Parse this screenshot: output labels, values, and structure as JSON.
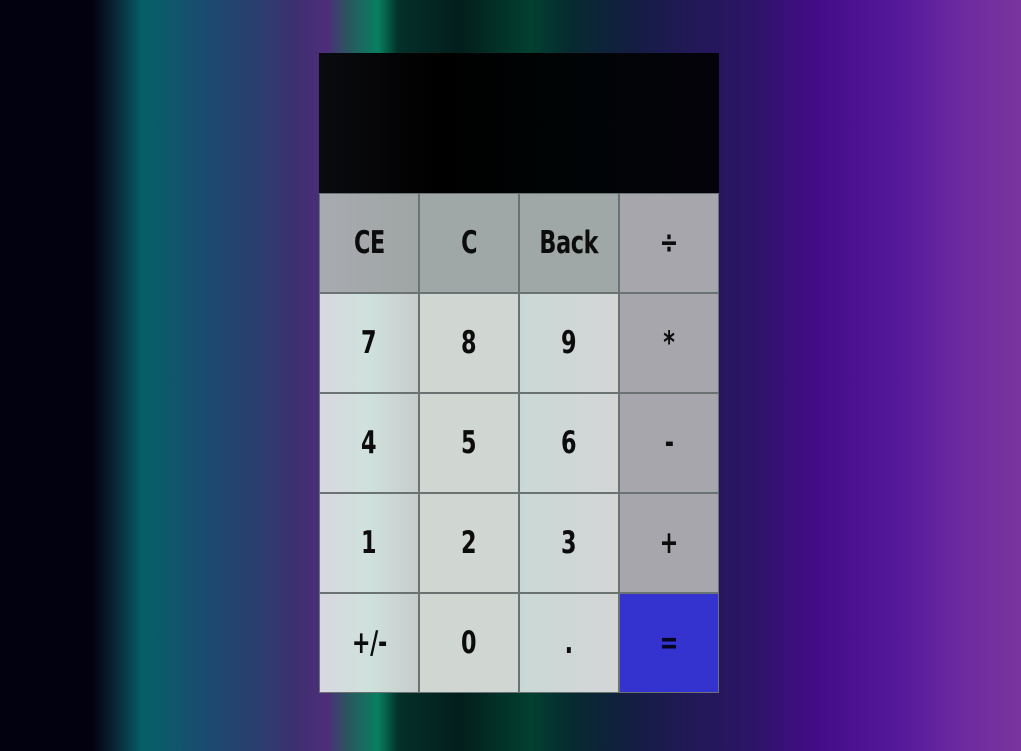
{
  "display": {
    "value": ""
  },
  "keys": [
    {
      "label": "CE",
      "name": "clear-entry-button",
      "kind": "fn"
    },
    {
      "label": "C",
      "name": "clear-button",
      "kind": "fn2"
    },
    {
      "label": "Back",
      "name": "backspace-button",
      "kind": "fn2"
    },
    {
      "label": "÷",
      "name": "divide-button",
      "kind": "op"
    },
    {
      "label": "7",
      "name": "digit-7-button",
      "kind": "num1"
    },
    {
      "label": "8",
      "name": "digit-8-button",
      "kind": "num2"
    },
    {
      "label": "9",
      "name": "digit-9-button",
      "kind": "num3"
    },
    {
      "label": "*",
      "name": "multiply-button",
      "kind": "op"
    },
    {
      "label": "4",
      "name": "digit-4-button",
      "kind": "num1"
    },
    {
      "label": "5",
      "name": "digit-5-button",
      "kind": "num2"
    },
    {
      "label": "6",
      "name": "digit-6-button",
      "kind": "num3"
    },
    {
      "label": "-",
      "name": "subtract-button",
      "kind": "op"
    },
    {
      "label": "1",
      "name": "digit-1-button",
      "kind": "num1"
    },
    {
      "label": "2",
      "name": "digit-2-button",
      "kind": "num2"
    },
    {
      "label": "3",
      "name": "digit-3-button",
      "kind": "num3"
    },
    {
      "label": "+",
      "name": "add-button",
      "kind": "op"
    },
    {
      "label": "+/-",
      "name": "toggle-sign-button",
      "kind": "num1"
    },
    {
      "label": "0",
      "name": "digit-0-button",
      "kind": "num2"
    },
    {
      "label": ".",
      "name": "decimal-point-button",
      "kind": "num3"
    },
    {
      "label": "=",
      "name": "equals-button",
      "kind": "eq"
    }
  ],
  "colors": {
    "equals_key": "#3433cf",
    "operator_key": "#a6a6ac",
    "function_key": "#9fa8a6",
    "display_background": "#000000"
  }
}
